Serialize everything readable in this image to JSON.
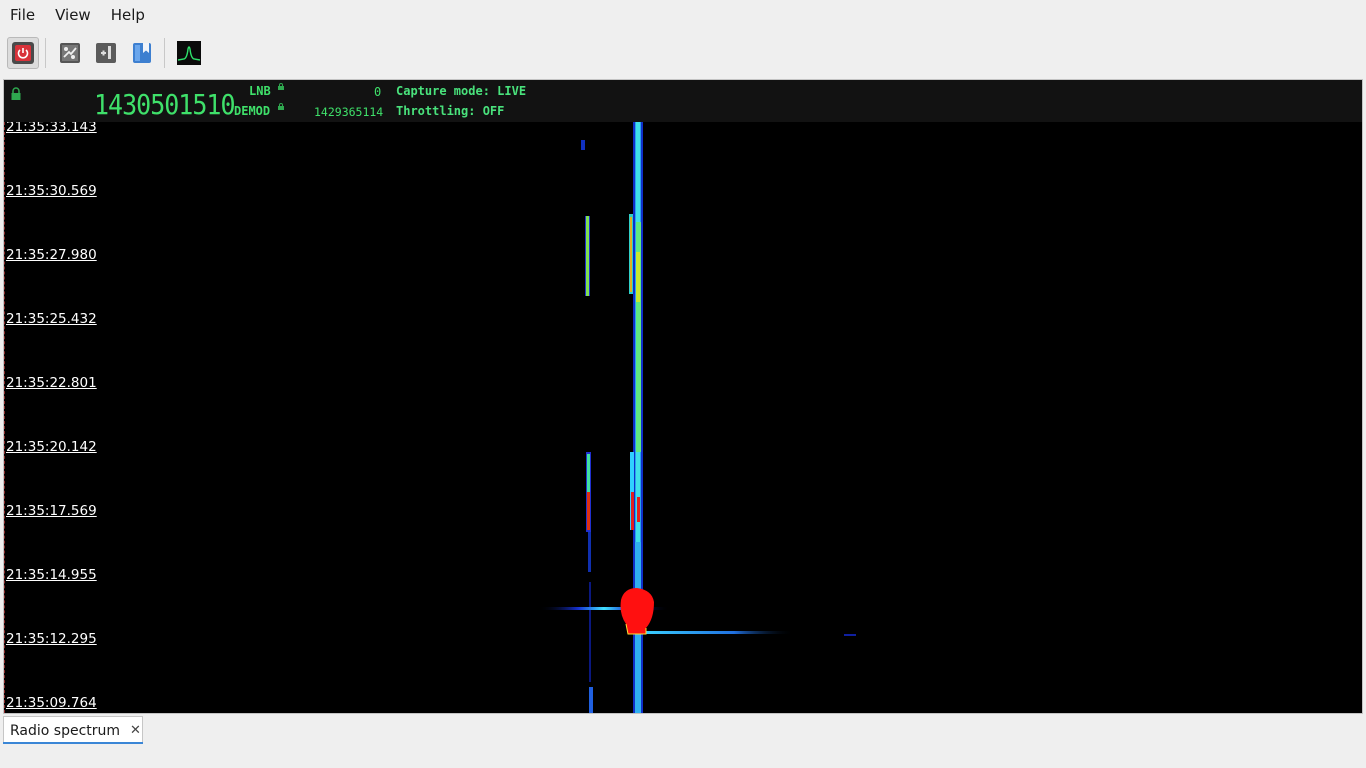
{
  "menu": {
    "file": "File",
    "view": "View",
    "help": "Help"
  },
  "toolbar": {
    "buttons": [
      {
        "name": "power-icon"
      },
      {
        "name": "settings-panel-icon"
      },
      {
        "name": "record-icon"
      },
      {
        "name": "bookmark-icon"
      },
      {
        "name": "spectrum-icon"
      }
    ]
  },
  "info": {
    "frequency": "1430501510",
    "lnb_label": "LNB",
    "lnb_value": "0",
    "demod_label": "DEMOD",
    "demod_value": "1429365114",
    "capture_mode": "Capture mode: LIVE",
    "throttling": "Throttling: OFF"
  },
  "waterfall": {
    "timestamps": [
      "21:35:33.143",
      "21:35:30.569",
      "21:35:27.980",
      "21:35:25.432",
      "21:35:22.801",
      "21:35:20.142",
      "21:35:17.569",
      "21:35:14.955",
      "21:35:12.295",
      "21:35:09.764"
    ]
  },
  "tabs": [
    {
      "label": "Radio spectrum",
      "close": "✕"
    }
  ],
  "colors": {
    "accent": "#3a86d6",
    "readout_green": "#3fe06a",
    "heat_low": "#1020c0",
    "heat_mid": "#30d0ff",
    "heat_high": "#e0e020",
    "heat_peak": "#ff1010"
  }
}
